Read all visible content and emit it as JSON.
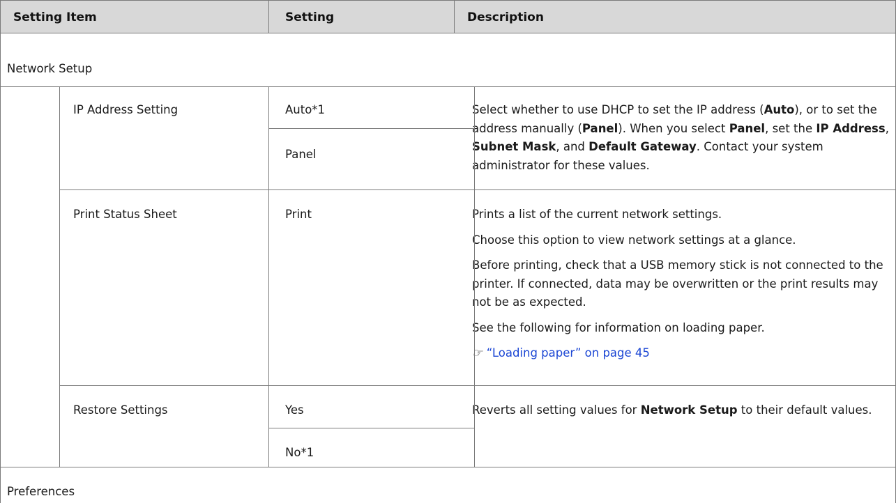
{
  "table": {
    "headers": {
      "setting_item": "Setting Item",
      "setting": "Setting",
      "description": "Description"
    },
    "sections": {
      "network_setup": "Network Setup",
      "preferences": "Preferences"
    },
    "rows": {
      "ip_address": {
        "item": "IP Address Setting",
        "options": [
          "Auto*1",
          "Panel"
        ],
        "desc": {
          "t1": "Select whether to use DHCP to set the IP address (",
          "b1": "Auto",
          "t2": "), or to set the address manually (",
          "b2": "Panel",
          "t3": "). When you select ",
          "b3": "Panel",
          "t4": ", set the ",
          "b4": "IP Address",
          "t5": ", ",
          "b5": "Subnet Mask",
          "t6": ", and ",
          "b6": "Default Gateway",
          "t7": ". Contact your system administrator for these values."
        }
      },
      "print_status": {
        "item": "Print Status Sheet",
        "option": "Print",
        "desc": [
          "Prints a list of the current network settings.",
          "Choose this option to view network settings at a glance.",
          "Before printing, check that a USB memory stick is not connected to the printer. If connected, data may be overwritten or the print results may not be as expected.",
          "See the following for information on loading paper."
        ],
        "link_icon": "reference-arrow-icon",
        "link_text": "“Loading paper” on page 45"
      },
      "restore": {
        "item": "Restore Settings",
        "options": [
          "Yes",
          "No*1"
        ],
        "desc": {
          "t1": "Reverts all setting values for ",
          "b1": "Network Setup",
          "t2": " to their default values."
        }
      }
    }
  },
  "colors": {
    "header_bg": "#d8d8d8",
    "border": "#7a7a7a",
    "link": "#1b46d4"
  }
}
